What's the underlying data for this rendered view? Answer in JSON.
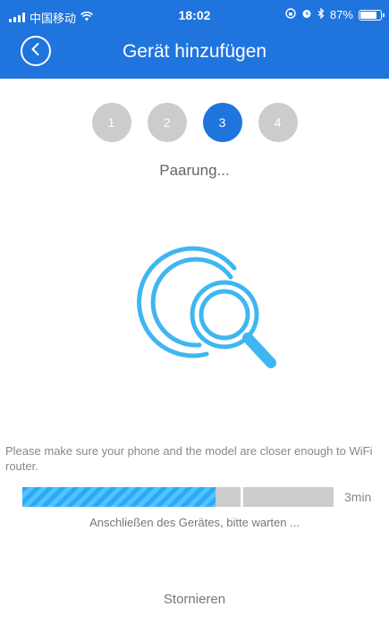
{
  "status_bar": {
    "carrier": "中国移动",
    "time": "18:02",
    "battery": "87%",
    "battery_level": 0.87
  },
  "header": {
    "title": "Gerät hinzufügen"
  },
  "steps": [
    "1",
    "2",
    "3",
    "4"
  ],
  "active_step": 3,
  "pairing_text": "Paarung...",
  "hint": "Please make sure your phone and the model are closer enough to WiFi router.",
  "progress": {
    "fraction": 0.62,
    "time_left": "3min"
  },
  "connecting_text": "Anschließen des Gerätes, bitte warten ...",
  "cancel_label": "Stornieren",
  "colors": {
    "header_blue": "#1f74de",
    "graphic_blue": "#3fb6f2",
    "inactive_step": "#cccccc"
  }
}
